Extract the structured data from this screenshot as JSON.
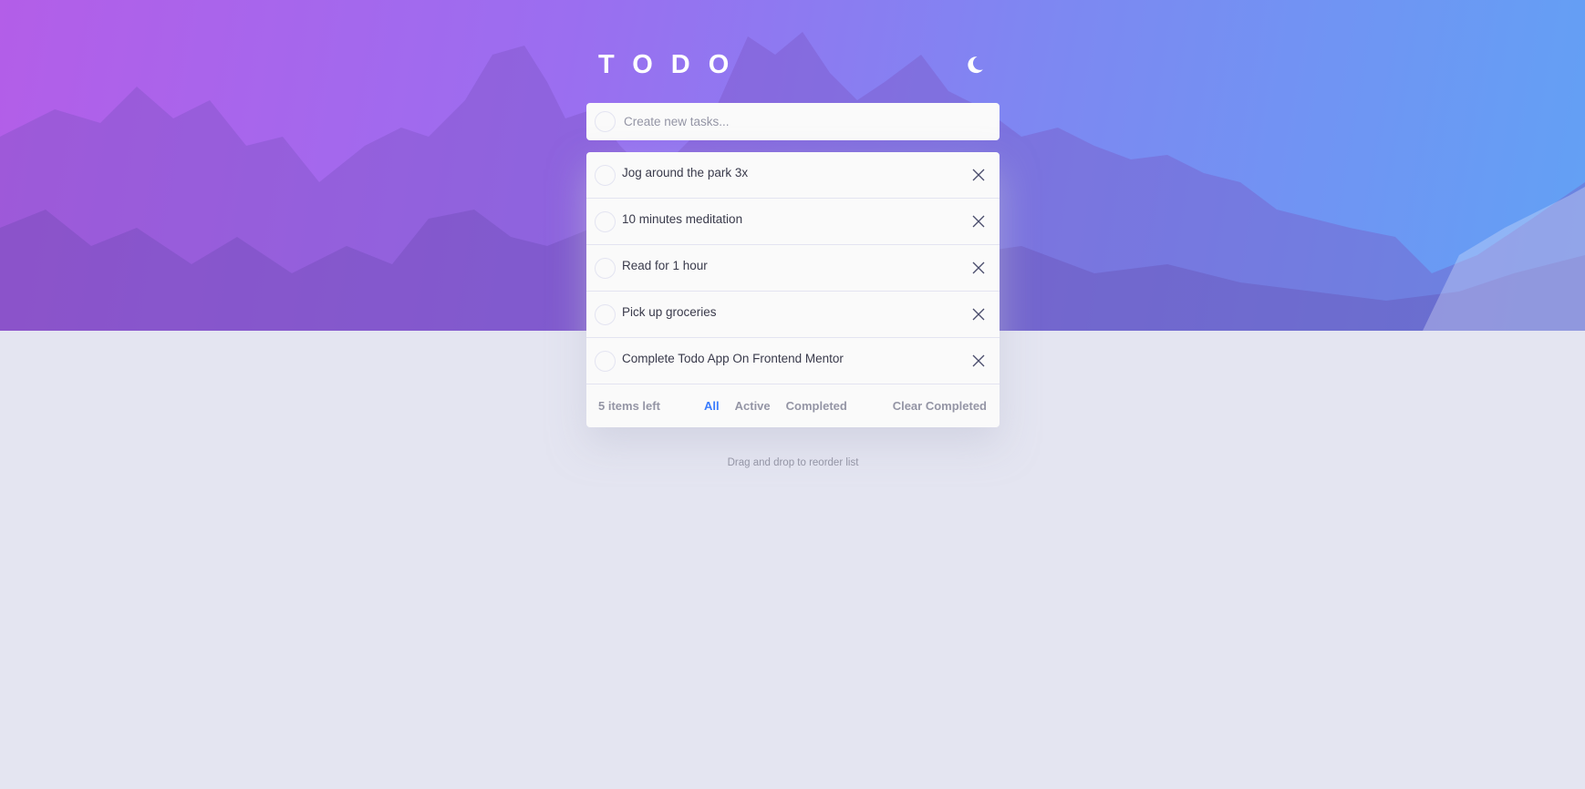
{
  "app": {
    "title": "TODO",
    "theme_toggle_icon": "moon-icon"
  },
  "create": {
    "placeholder": "Create new tasks..."
  },
  "tasks": [
    {
      "label": "Jog around the park 3x",
      "completed": false
    },
    {
      "label": "10 minutes meditation",
      "completed": false
    },
    {
      "label": "Read for 1 hour",
      "completed": false
    },
    {
      "label": "Pick up groceries",
      "completed": false
    },
    {
      "label": "Complete Todo App On Frontend Mentor",
      "completed": false
    }
  ],
  "footer": {
    "items_left": "5 items left",
    "filters": [
      "All",
      "Active",
      "Completed"
    ],
    "active_filter": "All",
    "clear_label": "Clear Completed"
  },
  "hint": "Drag and drop to reorder list",
  "colors": {
    "accent": "#3a7cfd",
    "page_background": "#e4e5f1",
    "card_background": "#fafafa",
    "hero_gradient_start": "#b35ee8",
    "hero_gradient_end": "#62a1f4"
  }
}
